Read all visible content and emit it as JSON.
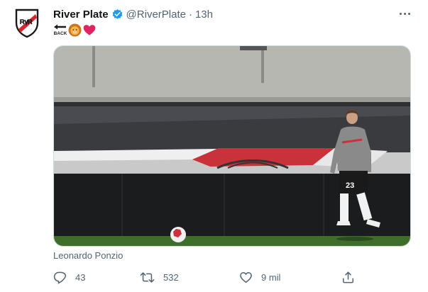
{
  "tweet": {
    "author_name": "River Plate",
    "handle": "@RiverPlate",
    "separator": "·",
    "time": "13h",
    "emoji_back_text": "BACK",
    "media_caption": "Leonardo Ponzio",
    "actions": {
      "reply_count": "43",
      "retweet_count": "532",
      "like_count": "9 mil"
    }
  },
  "photo": {
    "player_number": "23"
  },
  "colors": {
    "verified": "#1d9bf0",
    "heart": "#e0245e",
    "text_secondary": "#536471",
    "club_red": "#d9232e"
  }
}
